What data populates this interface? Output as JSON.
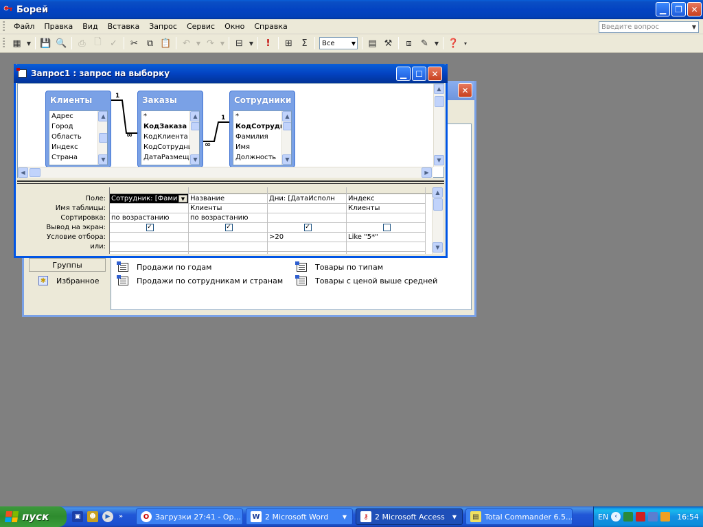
{
  "window": {
    "title": "Борей"
  },
  "menu": {
    "items": [
      {
        "label": "Файл"
      },
      {
        "label": "Правка"
      },
      {
        "label": "Вид"
      },
      {
        "label": "Вставка"
      },
      {
        "label": "Запрос"
      },
      {
        "label": "Сервис"
      },
      {
        "label": "Окно"
      },
      {
        "label": "Справка"
      }
    ],
    "ask_placeholder": "Введите вопрос"
  },
  "toolbar": {
    "top_values": "Все"
  },
  "db_window": {
    "groups_label": "Группы",
    "favorites_label": "Избранное",
    "objects": [
      {
        "label": "Продажи по годам"
      },
      {
        "label": "Продажи по сотрудникам и странам"
      },
      {
        "label": "Товары по типам"
      },
      {
        "label": "Товары с ценой выше средней"
      }
    ]
  },
  "query_window": {
    "title": "Запрос1 : запрос на выборку",
    "tables": [
      {
        "name": "Клиенты",
        "fields": [
          "Адрес",
          "Город",
          "Область",
          "Индекс",
          "Страна"
        ],
        "bold": []
      },
      {
        "name": "Заказы",
        "fields": [
          "*",
          "КодЗаказа",
          "КодКлиента",
          "КодСотрудни",
          "ДатаРазмещ"
        ],
        "bold": [
          "КодЗаказа"
        ]
      },
      {
        "name": "Сотрудники",
        "fields": [
          "*",
          "КодСотрудн",
          "Фамилия",
          "Имя",
          "Должность"
        ],
        "bold": [
          "КодСотрудн"
        ]
      }
    ],
    "relations": [
      {
        "one": "1",
        "many": "∞"
      },
      {
        "one": "1",
        "many": "∞"
      }
    ],
    "grid": {
      "row_labels": [
        "Поле:",
        "Имя таблицы:",
        "Сортировка:",
        "Вывод на экран:",
        "Условие отбора:",
        "или:"
      ],
      "columns": [
        {
          "field": "Сотрудник: [Фами",
          "table": "",
          "sort": "по возрастанию",
          "show": true,
          "criteria": "",
          "or": ""
        },
        {
          "field": "Название",
          "table": "Клиенты",
          "sort": "по возрастанию",
          "show": true,
          "criteria": "",
          "or": ""
        },
        {
          "field": "Дни: [ДатаИсполн",
          "table": "",
          "sort": "",
          "show": true,
          "criteria": ">20",
          "or": ""
        },
        {
          "field": "Индекс",
          "table": "Клиенты",
          "sort": "",
          "show": false,
          "criteria": "Like \"5*\"",
          "or": ""
        }
      ]
    }
  },
  "taskbar": {
    "start_label": "пуск",
    "buttons": [
      {
        "label": "Загрузки 27:41 - Op...",
        "icon": "opera-icon"
      },
      {
        "label": "2 Microsoft Word",
        "icon": "word-icon"
      },
      {
        "label": "2 Microsoft Access",
        "icon": "access-icon"
      },
      {
        "label": "Total Commander 6.5...",
        "icon": "total-commander-icon"
      }
    ],
    "language": "EN",
    "clock": "16:54"
  },
  "colors": {
    "xp_blue": "#0343c2",
    "desktop_bg": "#808080",
    "panel_bg": "#ece9d8",
    "start_green": "#3c9a3c"
  }
}
